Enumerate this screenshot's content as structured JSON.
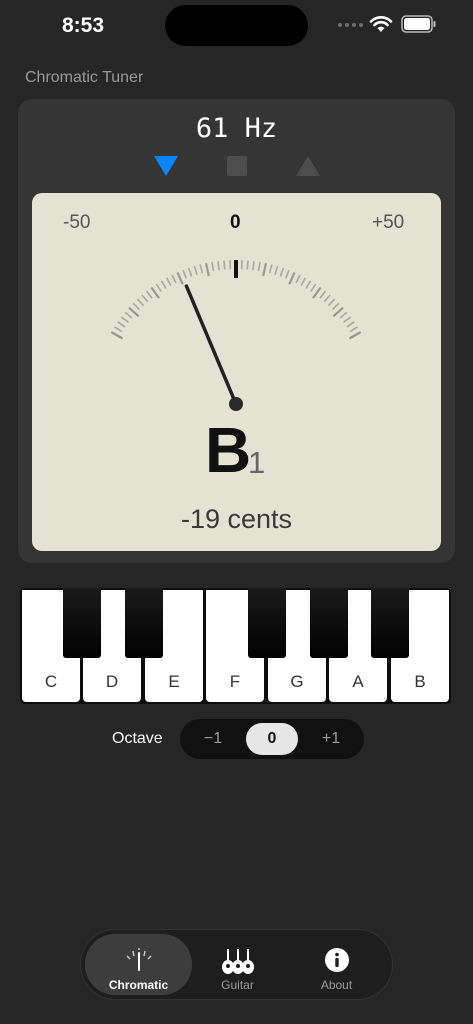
{
  "status": {
    "time": "8:53"
  },
  "app": {
    "title": "Chromatic Tuner"
  },
  "tuner": {
    "frequency": "61  Hz",
    "flat_active": true,
    "scale_left": "-50",
    "scale_center": "0",
    "scale_right": "+50",
    "needle_cents": -19,
    "note_letter": "B",
    "note_octave": "1",
    "cents_text": "-19 cents"
  },
  "keyboard": {
    "white_keys": [
      "C",
      "D",
      "E",
      "F",
      "G",
      "A",
      "B"
    ]
  },
  "octave": {
    "label": "Octave",
    "options": [
      "−1",
      "0",
      "+1"
    ],
    "selected": "0"
  },
  "tabs": [
    {
      "label": "Chromatic",
      "icon": "tuning-fork-icon",
      "active": true
    },
    {
      "label": "Guitar",
      "icon": "guitar-icon",
      "active": false
    },
    {
      "label": "About",
      "icon": "info-icon",
      "active": false
    }
  ],
  "colors": {
    "accent_blue": "#0a84ff",
    "background": "#262626",
    "meter_face": "#e3e3d4"
  }
}
